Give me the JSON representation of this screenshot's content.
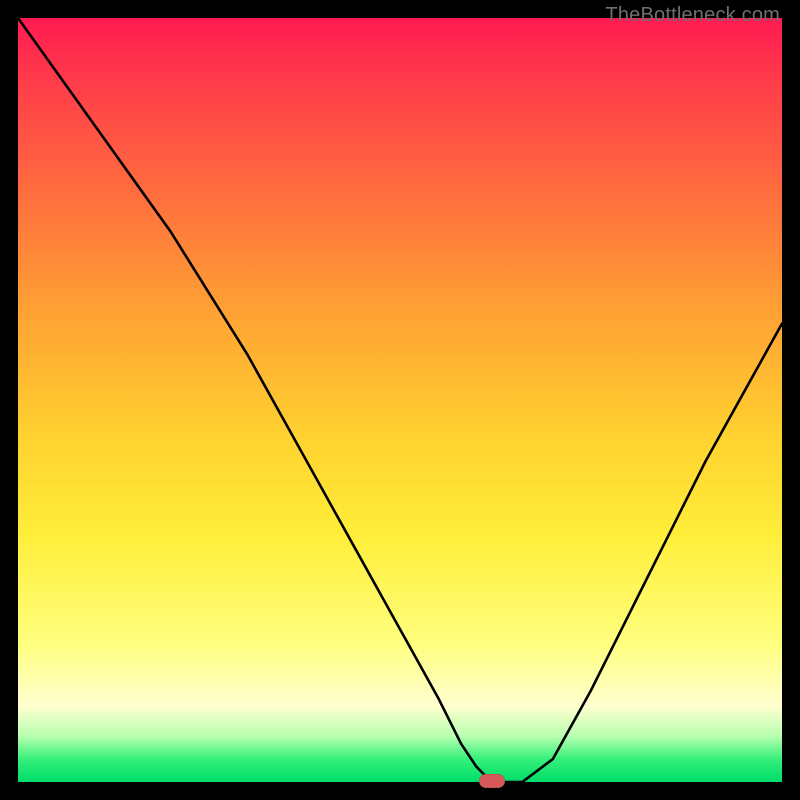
{
  "watermark": "TheBottleneck.com",
  "chart_data": {
    "type": "line",
    "title": "",
    "xlabel": "",
    "ylabel": "",
    "xlim": [
      0,
      100
    ],
    "ylim": [
      0,
      100
    ],
    "grid": false,
    "legend": false,
    "series": [
      {
        "name": "bottleneck-curve",
        "x": [
          0,
          5,
          10,
          15,
          20,
          25,
          30,
          35,
          40,
          45,
          50,
          55,
          58,
          60,
          62,
          64,
          66,
          70,
          75,
          80,
          85,
          90,
          95,
          100
        ],
        "y": [
          100,
          93,
          86,
          79,
          72,
          64,
          56,
          47,
          38,
          29,
          20,
          11,
          5,
          2,
          0,
          0,
          0,
          3,
          12,
          22,
          32,
          42,
          51,
          60
        ]
      }
    ],
    "marker": {
      "name": "optimal-point",
      "x": 62,
      "y": 0
    },
    "colors": {
      "gradient_top": "#ff1a52",
      "gradient_mid_orange": "#ffa034",
      "gradient_mid_yellow": "#ffee3a",
      "gradient_bottom": "#00dc6a",
      "curve": "#000000",
      "marker": "#d65a5a",
      "frame": "#000000"
    }
  }
}
